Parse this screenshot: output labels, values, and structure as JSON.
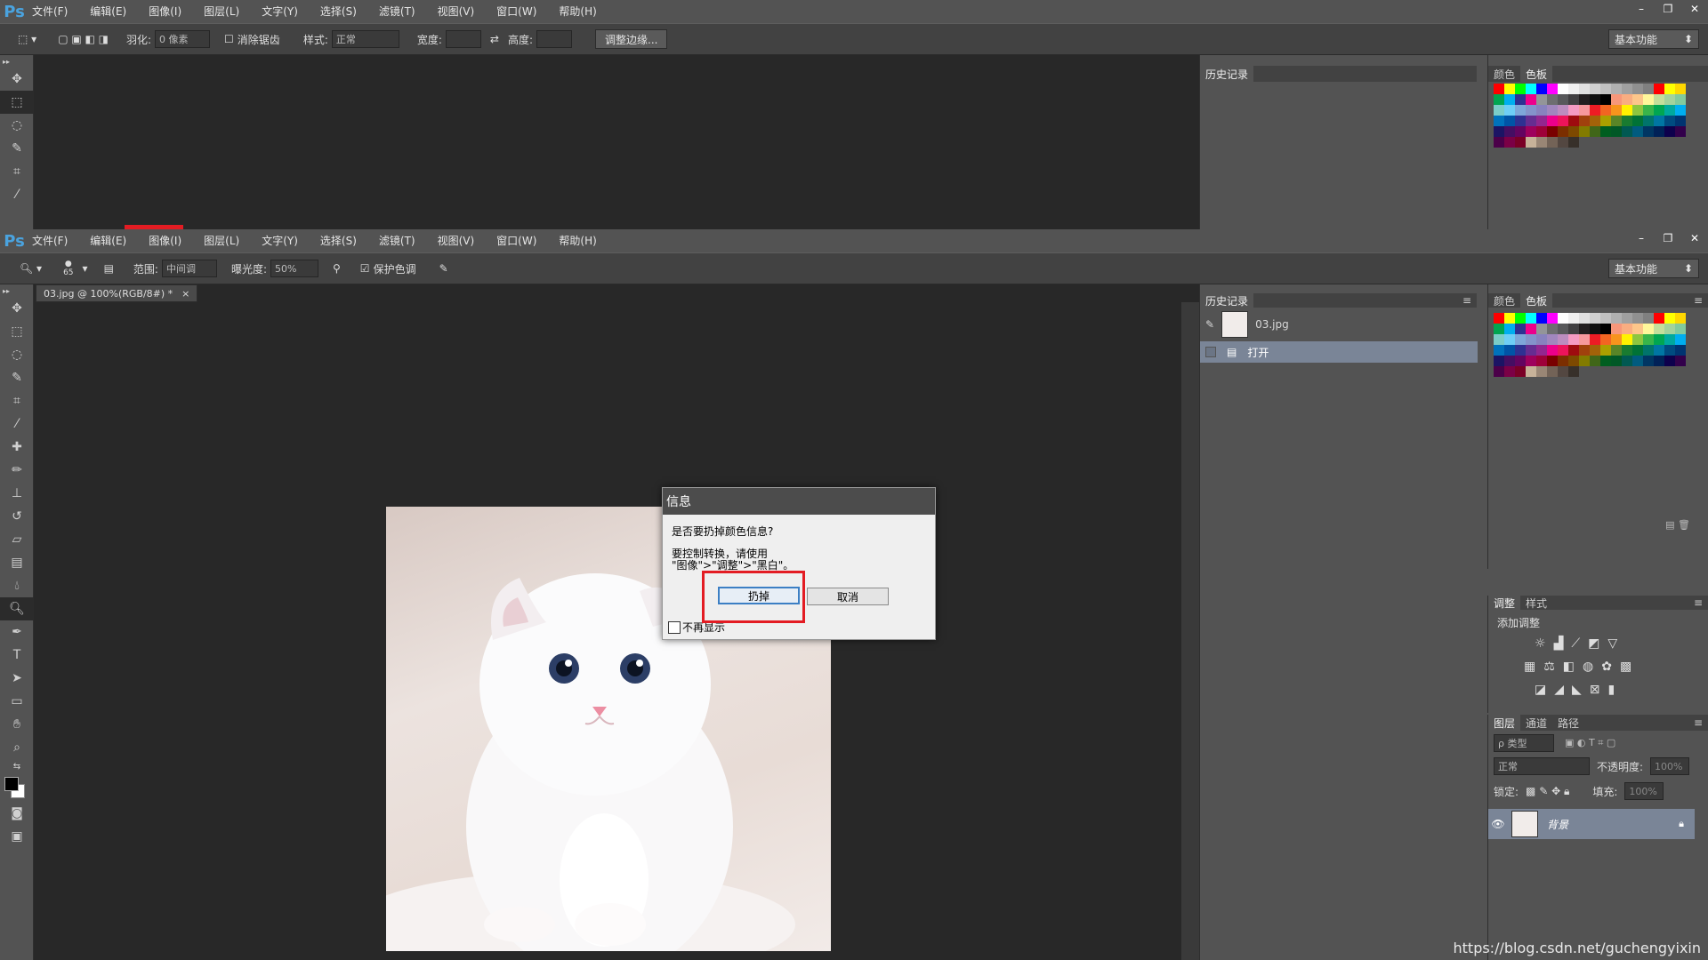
{
  "app": {
    "logo": "Ps"
  },
  "menu": [
    "文件(F)",
    "编辑(E)",
    "图像(I)",
    "图层(L)",
    "文字(Y)",
    "选择(S)",
    "滤镜(T)",
    "视图(V)",
    "窗口(W)",
    "帮助(H)"
  ],
  "window_controls": {
    "minimize": "–",
    "restore": "❐",
    "close": "✕"
  },
  "top_options": {
    "feather_label": "羽化:",
    "feather_value": "0 像素",
    "antialias_label": "消除锯齿",
    "style_label": "样式:",
    "style_value": "正常",
    "width_label": "宽度:",
    "height_label": "高度:",
    "refine_edge": "调整边缘..."
  },
  "workspace": "基本功能",
  "bottom_options": {
    "brush_size": "65",
    "range_label": "范围:",
    "range_value": "中间调",
    "exposure_label": "曝光度:",
    "exposure_value": "50%",
    "protect_tones": "保护色调"
  },
  "document_tab": {
    "title": "03.jpg @ 100%(RGB/8#) *",
    "close": "×"
  },
  "panels": {
    "history_tab": "历史记录",
    "color_tab": "颜色",
    "swatches_tab": "色板",
    "history_items": [
      "03.jpg",
      "打开"
    ],
    "adjust_tab": "调整",
    "styles_tab": "样式",
    "add_adjustment": "添加调整",
    "layers_tab": "图层",
    "channels_tab": "通道",
    "paths_tab": "路径",
    "kind_filter": "ρ 类型",
    "blend_mode": "正常",
    "opacity_label": "不透明度:",
    "opacity_value": "100%",
    "lock_label": "锁定:",
    "fill_label": "填充:",
    "fill_value": "100%",
    "layer_name": "背景"
  },
  "dialog": {
    "title": "信息",
    "question": "是否要扔掉颜色信息?",
    "hint_line1": "要控制转换，请使用",
    "hint_line2": "\"图像\">\"调整\">\"黑白\"。",
    "discard": "扔掉",
    "cancel": "取消",
    "dont_show": "不再显示"
  },
  "watermark": "https://blog.csdn.net/guchengyixin",
  "colors": {
    "highlight": "#e31c23",
    "ps_blue": "#4aa3df"
  },
  "swatch_colors": [
    "#ff0000",
    "#ffff00",
    "#00ff00",
    "#00ffff",
    "#0000ff",
    "#ff00ff",
    "#ffffff",
    "#f0f0f0",
    "#e0e0e0",
    "#d0d0d0",
    "#c0c0c0",
    "#b0b0b0",
    "#a0a0a0",
    "#909090",
    "#808080",
    "#ff0000",
    "#ffff00",
    "#ffd700",
    "#00a550",
    "#00aeef",
    "#2e3192",
    "#ec008c",
    "#939598",
    "#6d6e70",
    "#58595b",
    "#414042",
    "#231f20",
    "#111111",
    "#000000",
    "#f7977a",
    "#f9ad81",
    "#fdc68a",
    "#fff79a",
    "#c4df9b",
    "#a3d39c",
    "#82ca9d",
    "#7bcdc8",
    "#6ecff6",
    "#7ea7d8",
    "#8493ca",
    "#8882be",
    "#a187be",
    "#bc8dbf",
    "#f49ac2",
    "#f6989d",
    "#ed1c24",
    "#f26522",
    "#f7941d",
    "#fff200",
    "#8dc63f",
    "#39b54a",
    "#00a651",
    "#00a99d",
    "#00aeef",
    "#0072bc",
    "#0054a6",
    "#2e3192",
    "#662d91",
    "#92278f",
    "#ec008c",
    "#ed145b",
    "#9e0b0f",
    "#a0410d",
    "#a36209",
    "#aba000",
    "#598527",
    "#197b30",
    "#007236",
    "#00746b",
    "#0076a3",
    "#004b80",
    "#003471",
    "#1b1464",
    "#440e62",
    "#630460",
    "#9e005d",
    "#9e0039",
    "#790000",
    "#7b2e00",
    "#7d4900",
    "#827b00",
    "#406618",
    "#005e20",
    "#005826",
    "#005952",
    "#005b7f",
    "#003663",
    "#002157",
    "#0d004c",
    "#32004b",
    "#4b0049",
    "#7b0046",
    "#7a0026",
    "#c7b299",
    "#998675",
    "#736357",
    "#534741",
    "#37302a"
  ]
}
